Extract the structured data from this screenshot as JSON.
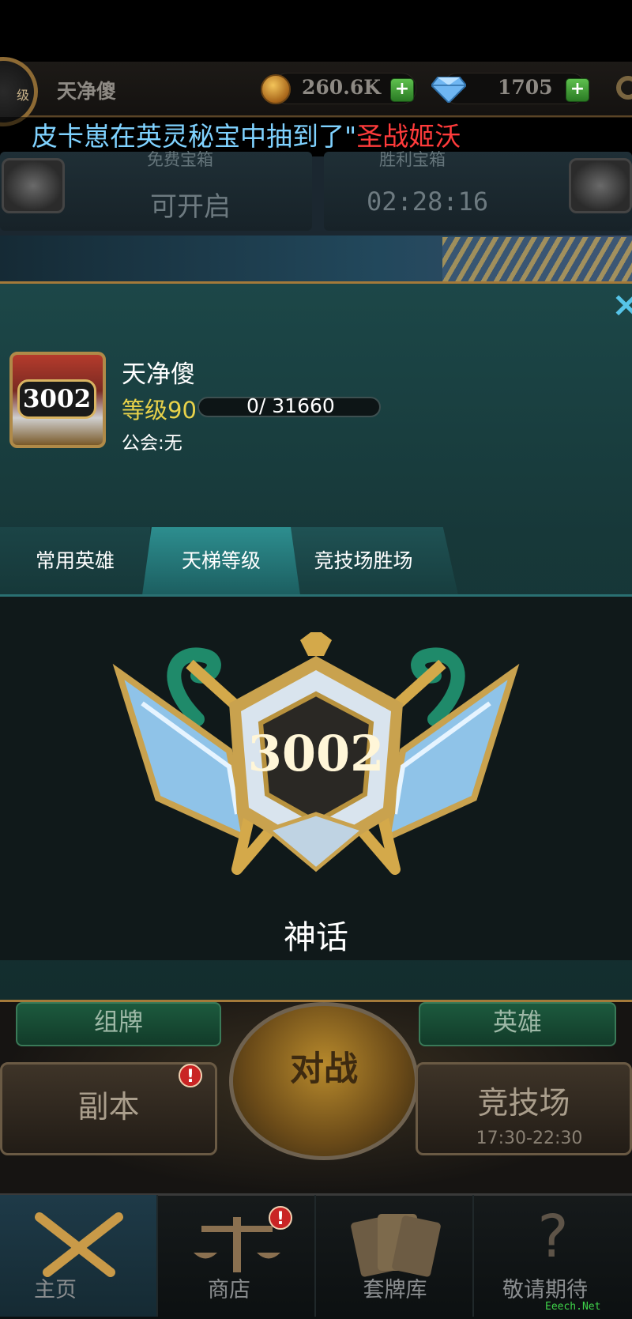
{
  "hud": {
    "player_name": "天净傻",
    "level_suffix": "级",
    "gold": "260.6K",
    "gems": "1705",
    "plus": "+",
    "marquee_prefix": "皮卡崽在英灵秘宝中抽到了\"",
    "marquee_highlight": "圣战姬沃"
  },
  "chests": {
    "left_label": "免费宝箱",
    "left_value": "可开启",
    "right_label": "胜利宝箱",
    "right_value": "02:28:16"
  },
  "profile": {
    "name": "天净傻",
    "level": "等级90",
    "xp": "0/ 31660",
    "xp_fraction": 0.0,
    "guild": "公会:无",
    "avatar_rating": "3002",
    "close": "×"
  },
  "tabs": [
    {
      "label": "常用英雄"
    },
    {
      "label": "天梯等级"
    },
    {
      "label": "竞技场胜场"
    }
  ],
  "rank": {
    "rating": "3002",
    "title": "神话"
  },
  "lobby": {
    "deck_tag": "组牌",
    "hero_tag": "英雄",
    "dungeon": "副本",
    "battle": "对战",
    "arena": "竞技场",
    "arena_time": "17:30-22:30",
    "alert": "!"
  },
  "nav": [
    {
      "label": "主页",
      "icon": "crossed-swords-icon"
    },
    {
      "label": "商店",
      "icon": "scales-icon"
    },
    {
      "label": "套牌库",
      "icon": "cards-icon"
    },
    {
      "label": "敬请期待",
      "icon": "question-icon"
    }
  ],
  "nav_icon_glyphs": {
    "question": "?"
  },
  "watermark": "Eeech.Net",
  "colors": {
    "accent": "#2d8e8f",
    "gold_text": "#e8d24a",
    "marquee_blue": "#7fd2ff",
    "marquee_red": "#ff3b3b",
    "border_gold": "#a47a3a"
  }
}
